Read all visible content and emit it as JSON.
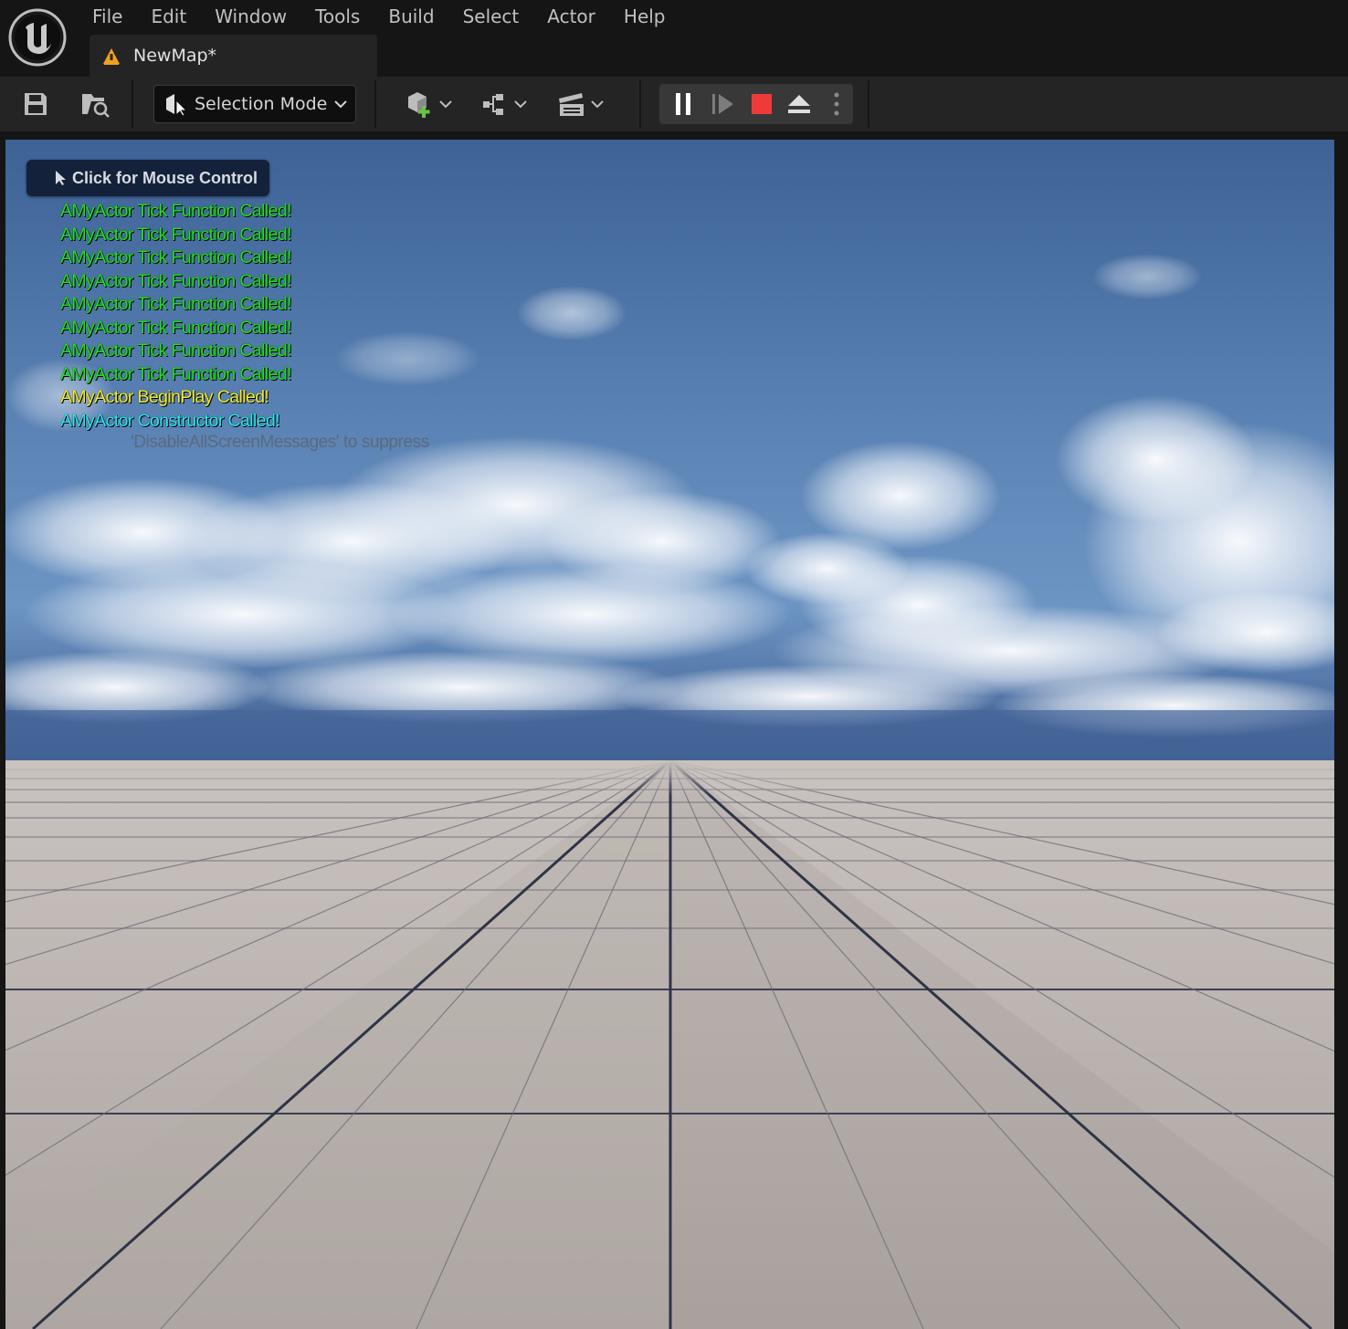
{
  "menu": {
    "items": [
      "File",
      "Edit",
      "Window",
      "Tools",
      "Build",
      "Select",
      "Actor",
      "Help"
    ]
  },
  "document_tab": {
    "label": "NewMap*",
    "icon": "level-warning-icon"
  },
  "toolbar": {
    "save_icon": "save-icon",
    "browse_icon": "content-browser-icon",
    "selection_mode_label": "Selection Mode",
    "add_actor_icon": "add-actor-icon",
    "blueprint_icon": "blueprint-icon",
    "cinematics_icon": "clapperboard-icon",
    "play_controls": [
      "pause-icon",
      "skip-frame-icon",
      "stop-icon",
      "eject-icon",
      "more-options-icon"
    ]
  },
  "viewport": {
    "mouse_control_label": "Click for Mouse Control",
    "messages": [
      {
        "text": "AMyActor Tick Function Called!",
        "color": "#22e022"
      },
      {
        "text": "AMyActor Tick Function Called!",
        "color": "#22e022"
      },
      {
        "text": "AMyActor Tick Function Called!",
        "color": "#22e022"
      },
      {
        "text": "AMyActor Tick Function Called!",
        "color": "#22e022"
      },
      {
        "text": "AMyActor Tick Function Called!",
        "color": "#22e022"
      },
      {
        "text": "AMyActor Tick Function Called!",
        "color": "#22e022"
      },
      {
        "text": "AMyActor Tick Function Called!",
        "color": "#22e022"
      },
      {
        "text": "AMyActor Tick Function Called!",
        "color": "#22e022"
      },
      {
        "text": "AMyActor BeginPlay Called!",
        "color": "#f2ec2a"
      },
      {
        "text": "AMyActor Constructor Called!",
        "color": "#2ee6ee"
      }
    ],
    "suppress_hint": "'DisableAllScreenMessages' to suppress"
  },
  "colors": {
    "accent_stop": "#f03a3a",
    "add_green": "#6cc24a",
    "warning_orange": "#f0a020"
  }
}
